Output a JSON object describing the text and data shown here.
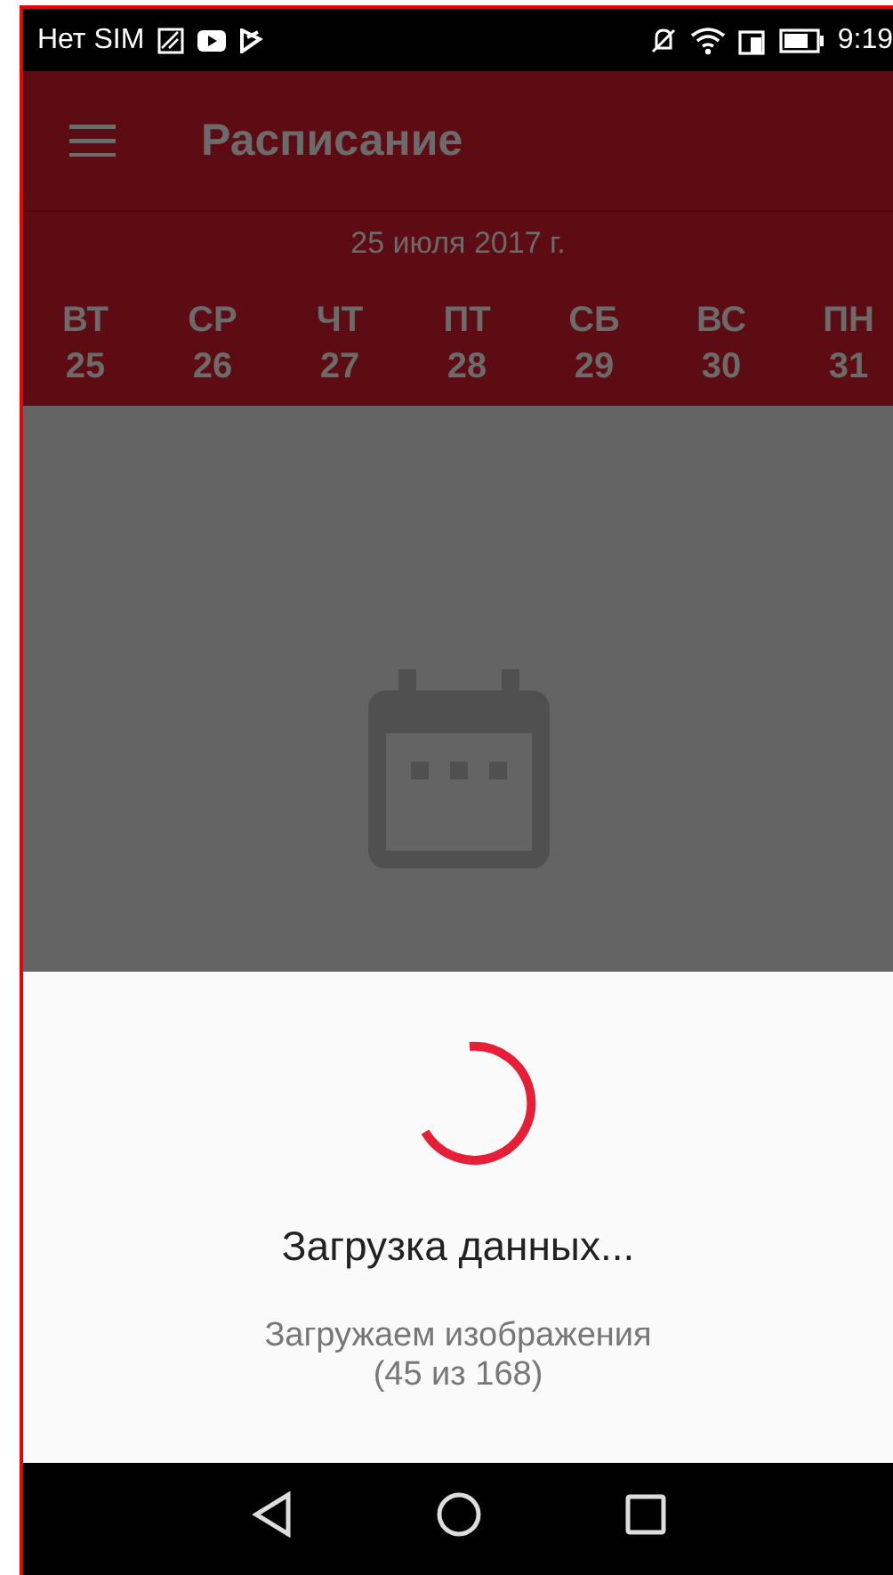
{
  "status_bar": {
    "carrier": "Нет SIM",
    "time": "9:19"
  },
  "app_bar": {
    "title": "Расписание"
  },
  "date": "25 июля 2017 г.",
  "days": [
    {
      "weekday": "ВТ",
      "day": "25"
    },
    {
      "weekday": "СР",
      "day": "26"
    },
    {
      "weekday": "ЧТ",
      "day": "27"
    },
    {
      "weekday": "ПТ",
      "day": "28"
    },
    {
      "weekday": "СБ",
      "day": "29"
    },
    {
      "weekday": "ВС",
      "day": "30"
    },
    {
      "weekday": "ПН",
      "day": "31"
    }
  ],
  "loading": {
    "title": "Загрузка данных...",
    "message": "Загружаем изображения",
    "progress": "(45 из 168)"
  }
}
